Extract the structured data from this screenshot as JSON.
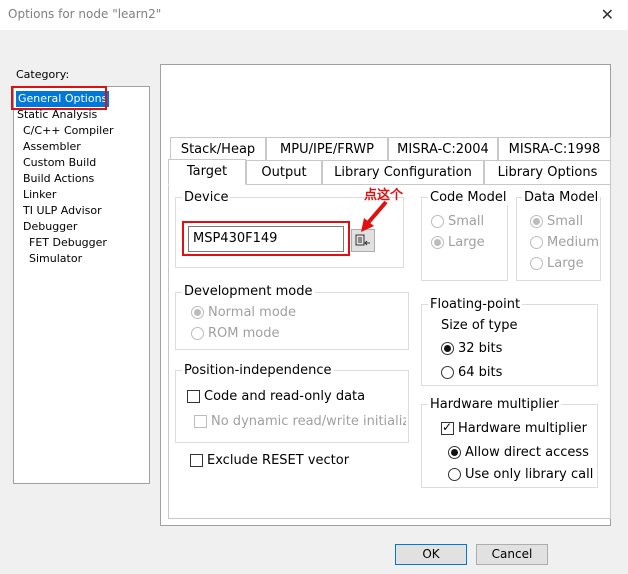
{
  "window": {
    "title": "Options for node \"learn2\""
  },
  "category": {
    "label": "Category:",
    "items": [
      "General Options",
      "Static Analysis",
      "C/C++ Compiler",
      "Assembler",
      "Custom Build",
      "Build Actions",
      "Linker",
      "TI ULP Advisor",
      "Debugger",
      "FET Debugger",
      "Simulator"
    ],
    "selected": "General Options"
  },
  "tabs_row1": [
    "Stack/Heap",
    "MPU/IPE/FRWP",
    "MISRA-C:2004",
    "MISRA-C:1998"
  ],
  "tabs_row2": [
    "Target",
    "Output",
    "Library Configuration",
    "Library Options"
  ],
  "active_tab": "Target",
  "device": {
    "label": "Device",
    "value": "MSP430F149"
  },
  "annotation": "点这个",
  "code_model": {
    "label": "Code Model",
    "options": [
      "Small",
      "Large"
    ],
    "selected": "Large"
  },
  "data_model": {
    "label": "Data Model",
    "options": [
      "Small",
      "Medium",
      "Large"
    ],
    "selected": "Small"
  },
  "dev_mode": {
    "label": "Development mode",
    "options": [
      "Normal mode",
      "ROM mode"
    ],
    "selected": "Normal mode"
  },
  "floating": {
    "label": "Floating-point",
    "sublabel": "Size of type",
    "options": [
      "32 bits",
      "64 bits"
    ],
    "selected": "32 bits"
  },
  "position": {
    "label": "Position-independence",
    "code_ro": "Code and read-only data",
    "no_dyn": "No dynamic read/write initializatio"
  },
  "hw_mult": {
    "label": "Hardware multiplier",
    "checkbox": "Hardware multiplier",
    "options": [
      "Allow direct access",
      "Use only library call"
    ],
    "selected": "Allow direct access"
  },
  "exclude_reset": "Exclude RESET vector",
  "buttons": {
    "ok": "OK",
    "cancel": "Cancel"
  },
  "colors": {
    "selection": "#0078d7",
    "annotation": "#e01010"
  }
}
